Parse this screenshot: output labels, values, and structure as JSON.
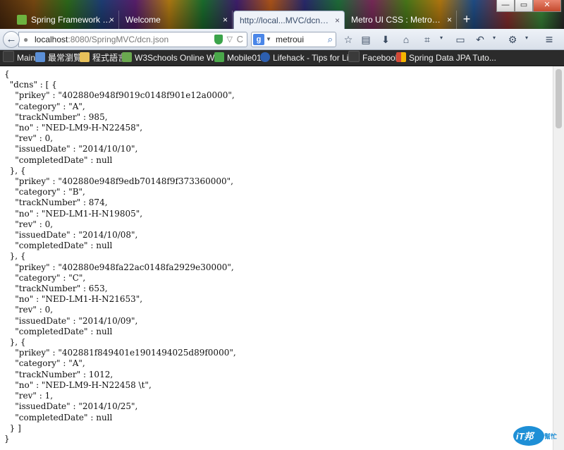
{
  "tabs": [
    {
      "label": "Spring Framework Re...",
      "close": "×",
      "active": false,
      "favicon_color": "#6db33f"
    },
    {
      "label": "Welcome",
      "close": "×",
      "active": false,
      "favicon_color": ""
    },
    {
      "label": "http://local...MVC/dcn.json",
      "close": "×",
      "active": true,
      "favicon_color": ""
    },
    {
      "label": "Metro UI CSS : Metro Boo...",
      "close": "×",
      "active": false,
      "favicon_color": ""
    }
  ],
  "new_tab": "+",
  "window_controls": {
    "minimize": "—",
    "maximize": "▭",
    "close": "✕"
  },
  "navbar": {
    "back": "←",
    "url_host": "localhost",
    "url_path": ":8080/SpringMVC/dcn.json",
    "reload": "C",
    "star": "▽",
    "search_engine": "g",
    "search_value": "metroui",
    "search_go": "⌕"
  },
  "toolbar_icons": {
    "bookmark_star": "☆",
    "bookmarks_list": "▤",
    "download": "⬇",
    "home": "⌂",
    "crop": "⌗",
    "crop_drop": "▾",
    "chat": "▭",
    "undo": "↶",
    "undo_drop": "▾",
    "addon": "⚙",
    "addon_drop": "▾",
    "menu": "≡"
  },
  "bookmarks": [
    {
      "label": "Main",
      "icon_color": "#3a3a3a"
    },
    {
      "label": "最常瀏覽",
      "icon_color": "#5b8fd6"
    },
    {
      "label": "程式語言",
      "icon_color": "#e8c15a"
    },
    {
      "label": "W3Schools Online W...",
      "icon_color": "#6aa84f"
    },
    {
      "label": "Mobile01",
      "icon_color": "#4aa84a"
    },
    {
      "label": "Lifehack - Tips for Life",
      "icon_color": "#2d5fb0"
    },
    {
      "label": "Facebook",
      "icon_color": "#3a3a3a"
    },
    {
      "label": "Spring Data JPA Tuto...",
      "icon_color": "#d14836"
    }
  ],
  "json_lines": [
    "{",
    "  \"dcns\" : [ {",
    "    \"prikey\" : \"402880e948f9019c0148f901e12a0000\",",
    "    \"category\" : \"A\",",
    "    \"trackNumber\" : 985,",
    "    \"no\" : \"NED-LM9-H-N22458\",",
    "    \"rev\" : 0,",
    "    \"issuedDate\" : \"2014/10/10\",",
    "    \"completedDate\" : null",
    "  }, {",
    "    \"prikey\" : \"402880e948f9edb70148f9f373360000\",",
    "    \"category\" : \"B\",",
    "    \"trackNumber\" : 874,",
    "    \"no\" : \"NED-LM1-H-N19805\",",
    "    \"rev\" : 0,",
    "    \"issuedDate\" : \"2014/10/08\",",
    "    \"completedDate\" : null",
    "  }, {",
    "    \"prikey\" : \"402880e948fa22ac0148fa2929e30000\",",
    "    \"category\" : \"C\",",
    "    \"trackNumber\" : 653,",
    "    \"no\" : \"NED-LM1-H-N21653\",",
    "    \"rev\" : 0,",
    "    \"issuedDate\" : \"2014/10/09\",",
    "    \"completedDate\" : null",
    "  }, {",
    "    \"prikey\" : \"402881f849401e1901494025d89f0000\",",
    "    \"category\" : \"A\",",
    "    \"trackNumber\" : 1012,",
    "    \"no\" : \"NED-LM9-H-N22458 \\t\",",
    "    \"rev\" : 1,",
    "    \"issuedDate\" : \"2014/10/25\",",
    "    \"completedDate\" : null",
    "  } ]",
    "}"
  ],
  "watermark": {
    "main": "iT邦",
    "sub": "幫忙"
  }
}
